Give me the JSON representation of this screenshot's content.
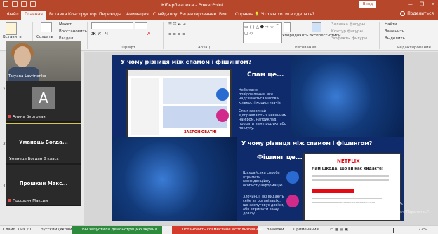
{
  "titlebar": {
    "title": "Кібербезпека  -  PowerPoint",
    "signin": "Вход",
    "controls": [
      "—",
      "❐",
      "✕"
    ]
  },
  "tabs": {
    "file": "Файл",
    "items": [
      "Главная",
      "Вставка",
      "Конструктор",
      "Переходы",
      "Анимация",
      "Слайд-шоу",
      "Рецензирование",
      "Вид",
      "Справка"
    ],
    "active": "Главная",
    "tellme": "Что вы хотите сделать?",
    "share": "Поделиться"
  },
  "ribbon": {
    "paste": "Вставить",
    "create": "Создать",
    "layout": "Макет",
    "restore": "Восстановить",
    "section": "Раздел",
    "font_group": "Шрифт",
    "paragraph_group": "Абзац",
    "drawing_group": "Рисование",
    "arrange": "Упорядочить",
    "express": "Экспресс-стили",
    "fill": "Заливка фигуры",
    "outline": "Контур фигуры",
    "effects": "Эффекты фигуры",
    "find": "Найти",
    "replace": "Заменить",
    "select": "Выделить",
    "editing_group": "Редактирование"
  },
  "thumbs": [
    "2",
    "3",
    "4"
  ],
  "participants": [
    {
      "name": "Tatyana Lavrinenko",
      "kind": "video"
    },
    {
      "name": "Алина Буртовая",
      "kind": "avatar",
      "initial": "A"
    },
    {
      "name": "Уманець Богдан 8 класс",
      "big": "Уманець  Богда...",
      "kind": "text"
    },
    {
      "name": "Прошкин Максим",
      "big": "Прошкин  Макс...",
      "kind": "text"
    }
  ],
  "slide1": {
    "title": "У чому різниця між спамом і фішингом?",
    "heading": "Спам це...",
    "text1": "Небажане повідомлення, яке надсилається масовій кількості користувачів.",
    "text2": "Спам зазвичай відправляють з невинним наміром, наприклад, продати вам продукт або послугу.",
    "screen_label": "ЗАБРОНЮВАТИ!"
  },
  "slide2": {
    "title": "У чому різниця між спамом і фішингом?",
    "heading": "Фішинг це...",
    "text1": "Шахрайська спроба отримати конфіденційну особисту інформацію.",
    "text2": "Злочинці, які видають себе за організацію, що заслуговує довіри, або отримати вашу довіру.",
    "netflix": "NETFLIX",
    "netflix_msg": "Нам шкода, що ви нас кидаєте!"
  },
  "watermark": {
    "line1": "Активация Windows",
    "line2": "Чтобы активировать Windows, перейдите в раздел \"Параметры\"."
  },
  "status": {
    "slide": "Слайд 3 из 20",
    "lang": "русский (Украина)",
    "share_screen": "Вы запустили демонстрацию экрана",
    "stop_share": "Остановить совместное использование",
    "notes": "Заметки",
    "comments": "Примечания",
    "zoom": "72%"
  }
}
